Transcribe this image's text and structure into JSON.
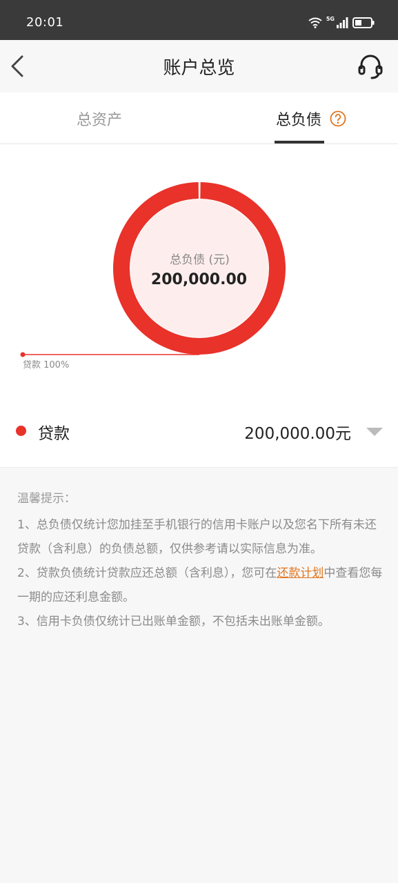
{
  "status_bar": {
    "time": "20:01",
    "network": "5G"
  },
  "nav": {
    "title": "账户总览"
  },
  "tabs": [
    {
      "label": "总资产",
      "active": false
    },
    {
      "label": "总负债",
      "active": true
    }
  ],
  "chart_data": {
    "type": "pie",
    "center_label": "总负债 (元)",
    "center_value": "200,000.00",
    "slices": [
      {
        "name": "贷款",
        "percent": 100,
        "color": "#e8322a"
      }
    ],
    "slice_label": "贷款 100%"
  },
  "summary": {
    "label": "贷款",
    "value": "200,000.00元",
    "dot_color": "#e8322a"
  },
  "tips": {
    "title": "温馨提示：",
    "item1": "1、总负债仅统计您加挂至手机银行的信用卡账户以及您名下所有未还贷款（含利息）的负债总额，仅供参考请以实际信息为准。",
    "item2_before": "2、贷款负债统计贷款应还总额（含利息），您可在",
    "item2_link": "还款计划",
    "item2_after": "中查看您每一期的应还利息金额。",
    "item3": "3、信用卡负债仅统计已出账单金额，不包括未出账单金额。"
  },
  "colors": {
    "accent": "#e8322a",
    "link": "#e0751f"
  }
}
